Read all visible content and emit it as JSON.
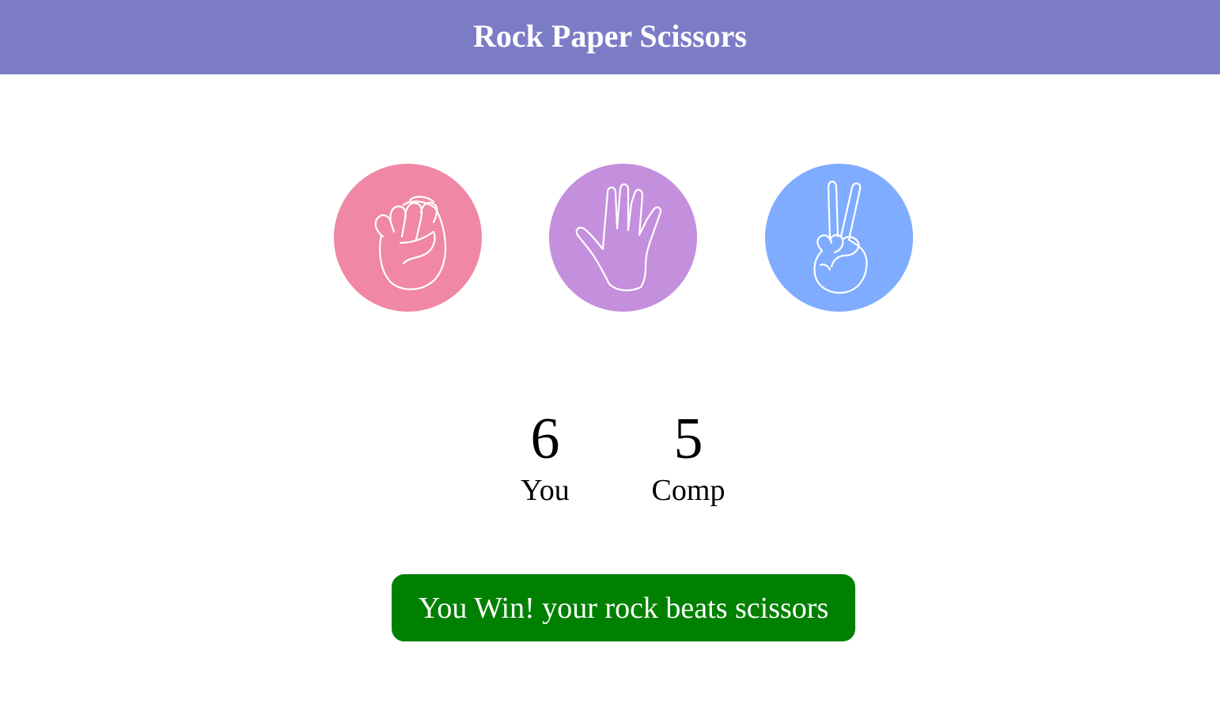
{
  "header": {
    "title": "Rock Paper Scissors",
    "color": "#7c7cc6"
  },
  "choices": [
    {
      "id": "rock",
      "icon": "fist-icon",
      "color": "#f087a4"
    },
    {
      "id": "paper",
      "icon": "open-hand-icon",
      "color": "#c48fdd"
    },
    {
      "id": "scissors",
      "icon": "peace-hand-icon",
      "color": "#80acff"
    }
  ],
  "scoreboard": {
    "user": {
      "score": "6",
      "label": "You"
    },
    "comp": {
      "score": "5",
      "label": "Comp"
    }
  },
  "message": {
    "text": "You Win! your rock beats scissors",
    "color": "#008000"
  }
}
